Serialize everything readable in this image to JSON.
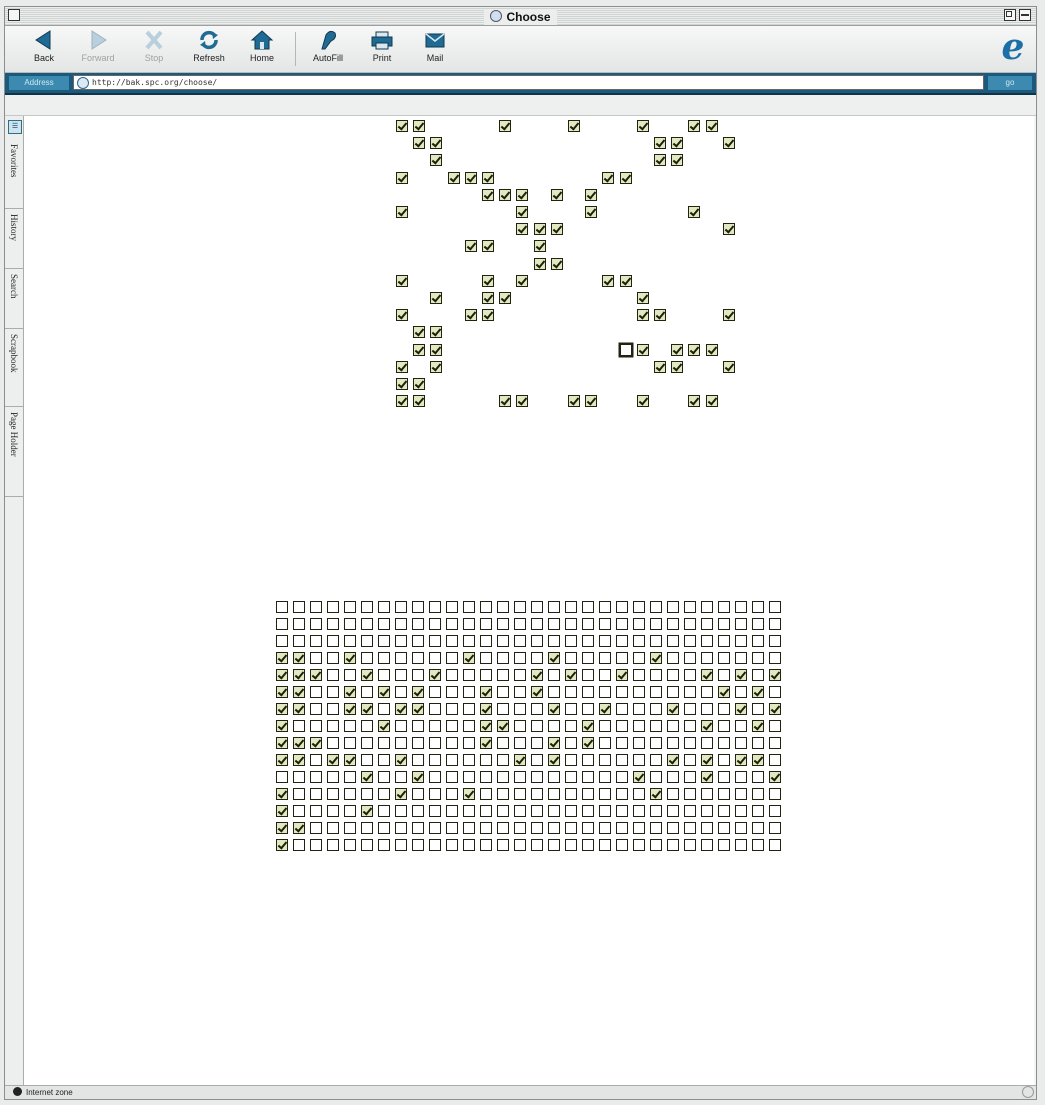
{
  "window": {
    "title": "Choose"
  },
  "toolbar": {
    "buttons": [
      {
        "label": "Back",
        "icon": "back-arrow-icon",
        "enabled": true
      },
      {
        "label": "Forward",
        "icon": "forward-arrow-icon",
        "enabled": false
      },
      {
        "label": "Stop",
        "icon": "stop-icon",
        "enabled": false
      },
      {
        "label": "Refresh",
        "icon": "refresh-icon",
        "enabled": true
      },
      {
        "label": "Home",
        "icon": "home-icon",
        "enabled": true
      },
      {
        "label": "AutoFill",
        "icon": "autofill-icon",
        "enabled": true
      },
      {
        "label": "Print",
        "icon": "printer-icon",
        "enabled": true
      },
      {
        "label": "Mail",
        "icon": "mail-icon",
        "enabled": true
      }
    ],
    "brand_logo": "e"
  },
  "address_bar": {
    "label": "Address",
    "url": "http://bak.spc.org/choose/",
    "go_label": "go"
  },
  "explorer_tabs": [
    "Favorites",
    "History",
    "Search",
    "Scrapbook",
    "Page Holder"
  ],
  "status_bar": {
    "zone": "Internet zone"
  },
  "colors": {
    "checkbox_border": "#1e2410",
    "checked_fill": "#e3e8c3",
    "address_bar": "#1b5a7c"
  },
  "top_pattern": {
    "rows": [
      "11000010001000100110",
      "01100000000000011001",
      "00100000000000011000",
      "10011100000011000000",
      "00000111010100000000",
      "10000001000100000100",
      "00000001110000000001",
      "00001100100000000000",
      "00000000110000000000",
      "10000101000011000000",
      "00100110000000100000",
      "10001100000000110001",
      "01100000000000000000",
      "01100000000000101110",
      "10100000000000011001",
      "11000000000000000000",
      "11000011001100100110"
    ],
    "focused_cell": [
      13,
      13
    ]
  },
  "bottom_grid": {
    "rows": [
      "000000000000000000000000000000",
      "000000000000000000000000000000",
      "000000000000000000000000000000",
      "110010000001000010000010000000",
      "111001000100000101001000010101",
      "110010101000100100000000001010",
      "110011011000100010010001000101",
      "100000100000110000100000010010",
      "111000000000100010100000000000",
      "110110010000001010000001010110",
      "000001001000000000000100010001",
      "100000010001000000000010000000",
      "100001000000000000000000000000",
      "110000000000000000000000000000",
      "100000000000000000000000000000"
    ]
  }
}
